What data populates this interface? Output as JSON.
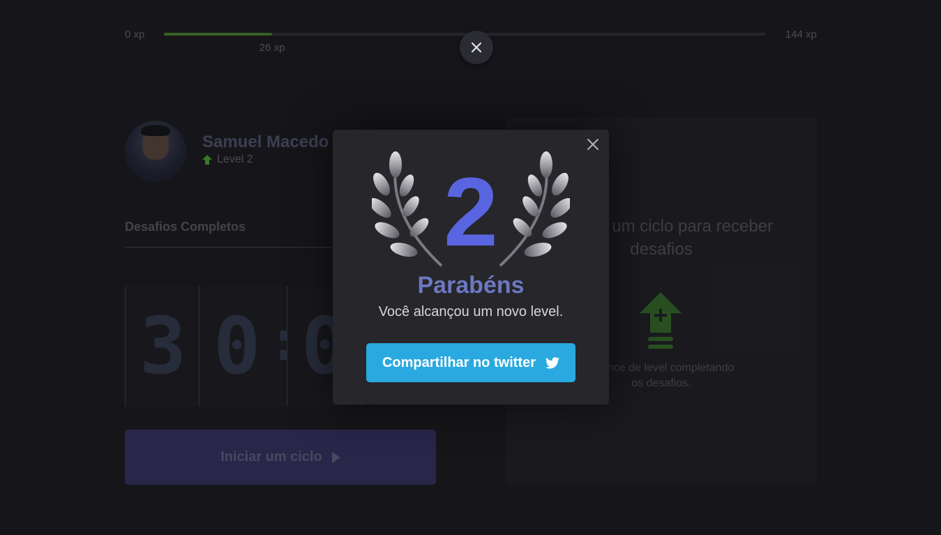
{
  "xp": {
    "min_label": "0 xp",
    "max_label": "144 xp",
    "current_label": "26 xp",
    "progress_fraction": 0.18
  },
  "profile": {
    "name": "Samuel Macedo",
    "level_label": "Level 2"
  },
  "challenges": {
    "completed_label": "Desafios Completos"
  },
  "countdown": {
    "minute_tens": "3",
    "minute_ones": "0",
    "separator": ":",
    "second_tens": "0"
  },
  "start_button": {
    "label": "Iniciar um ciclo"
  },
  "challenge_card": {
    "title": "Finalize um ciclo para receber desafios",
    "description": "Avance de level completando os desafios."
  },
  "modal": {
    "level": "2",
    "title": "Parabéns",
    "subtitle": "Você alcançou um novo level.",
    "share_label": "Compartilhar no twitter"
  },
  "colors": {
    "accent_blue": "#5965e0",
    "twitter_blue": "#2aa9e0",
    "green": "#4cd62b"
  },
  "icons": [
    "close-icon",
    "level-up-icon",
    "play-icon",
    "laurel-icon",
    "twitter-icon"
  ]
}
